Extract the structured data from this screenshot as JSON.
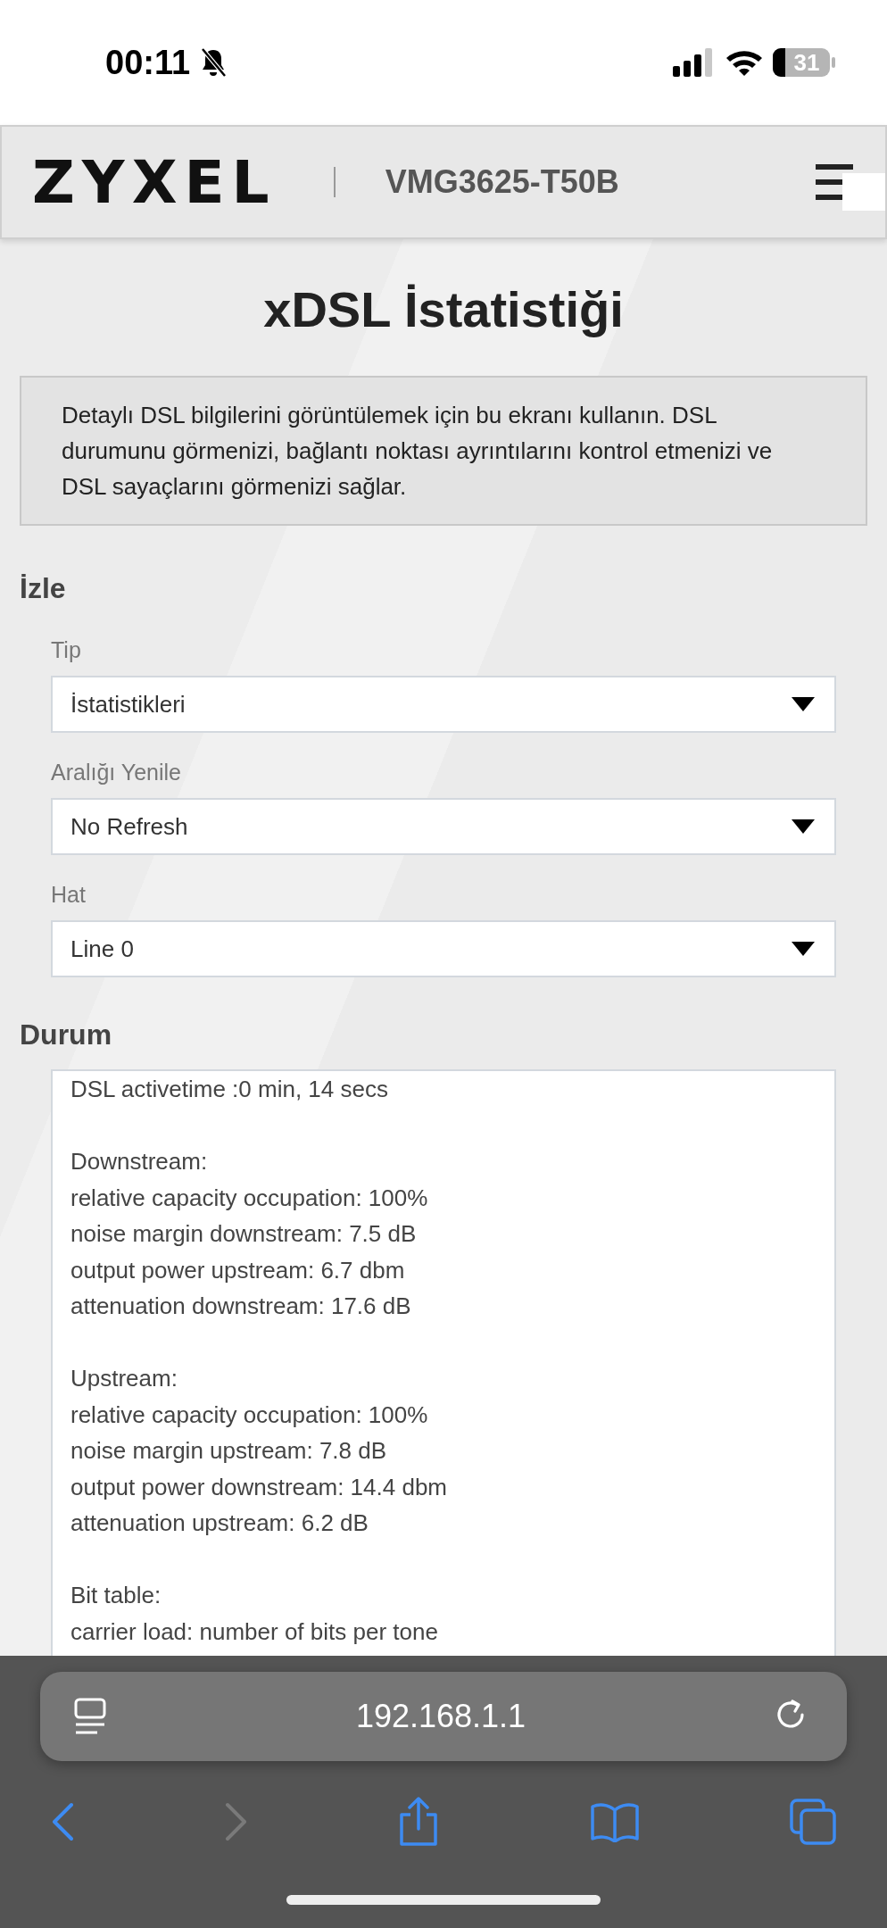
{
  "status_bar": {
    "time": "00:11",
    "silent": true,
    "battery": "31"
  },
  "header": {
    "logo": "ZYXEL",
    "model": "VMG3625-T50B"
  },
  "page_title": "xDSL İstatistiği",
  "description": "Detaylı DSL bilgilerini görüntülemek için bu ekranı kullanın. DSL durumunu görmenizi, bağlantı noktası ayrıntılarını kontrol etmenizi ve DSL sayaçlarını görmenizi sağlar.",
  "monitor": {
    "heading": "İzle",
    "fields": [
      {
        "label": "Tip",
        "value": "İstatistikleri"
      },
      {
        "label": "Aralığı Yenile",
        "value": "No Refresh"
      },
      {
        "label": "Hat",
        "value": "Line 0"
      }
    ]
  },
  "status": {
    "heading": "Durum",
    "log_groups": [
      [
        "DSL activetime :0 min, 14 secs"
      ],
      [
        "Downstream:",
        "relative capacity occupation: 100%",
        "noise margin downstream: 7.5 dB",
        "output power upstream: 6.7 dbm",
        "attenuation downstream: 17.6 dB"
      ],
      [
        "Upstream:",
        "relative capacity occupation: 100%",
        "noise margin upstream: 7.8 dB",
        "output power downstream: 14.4 dbm",
        "attenuation upstream: 6.2 dB"
      ],
      [
        "Bit table:",
        "carrier load: number of bits per tone"
      ]
    ]
  },
  "browser": {
    "url": "192.168.1.1",
    "back_disabled": false,
    "forward_disabled": true
  }
}
